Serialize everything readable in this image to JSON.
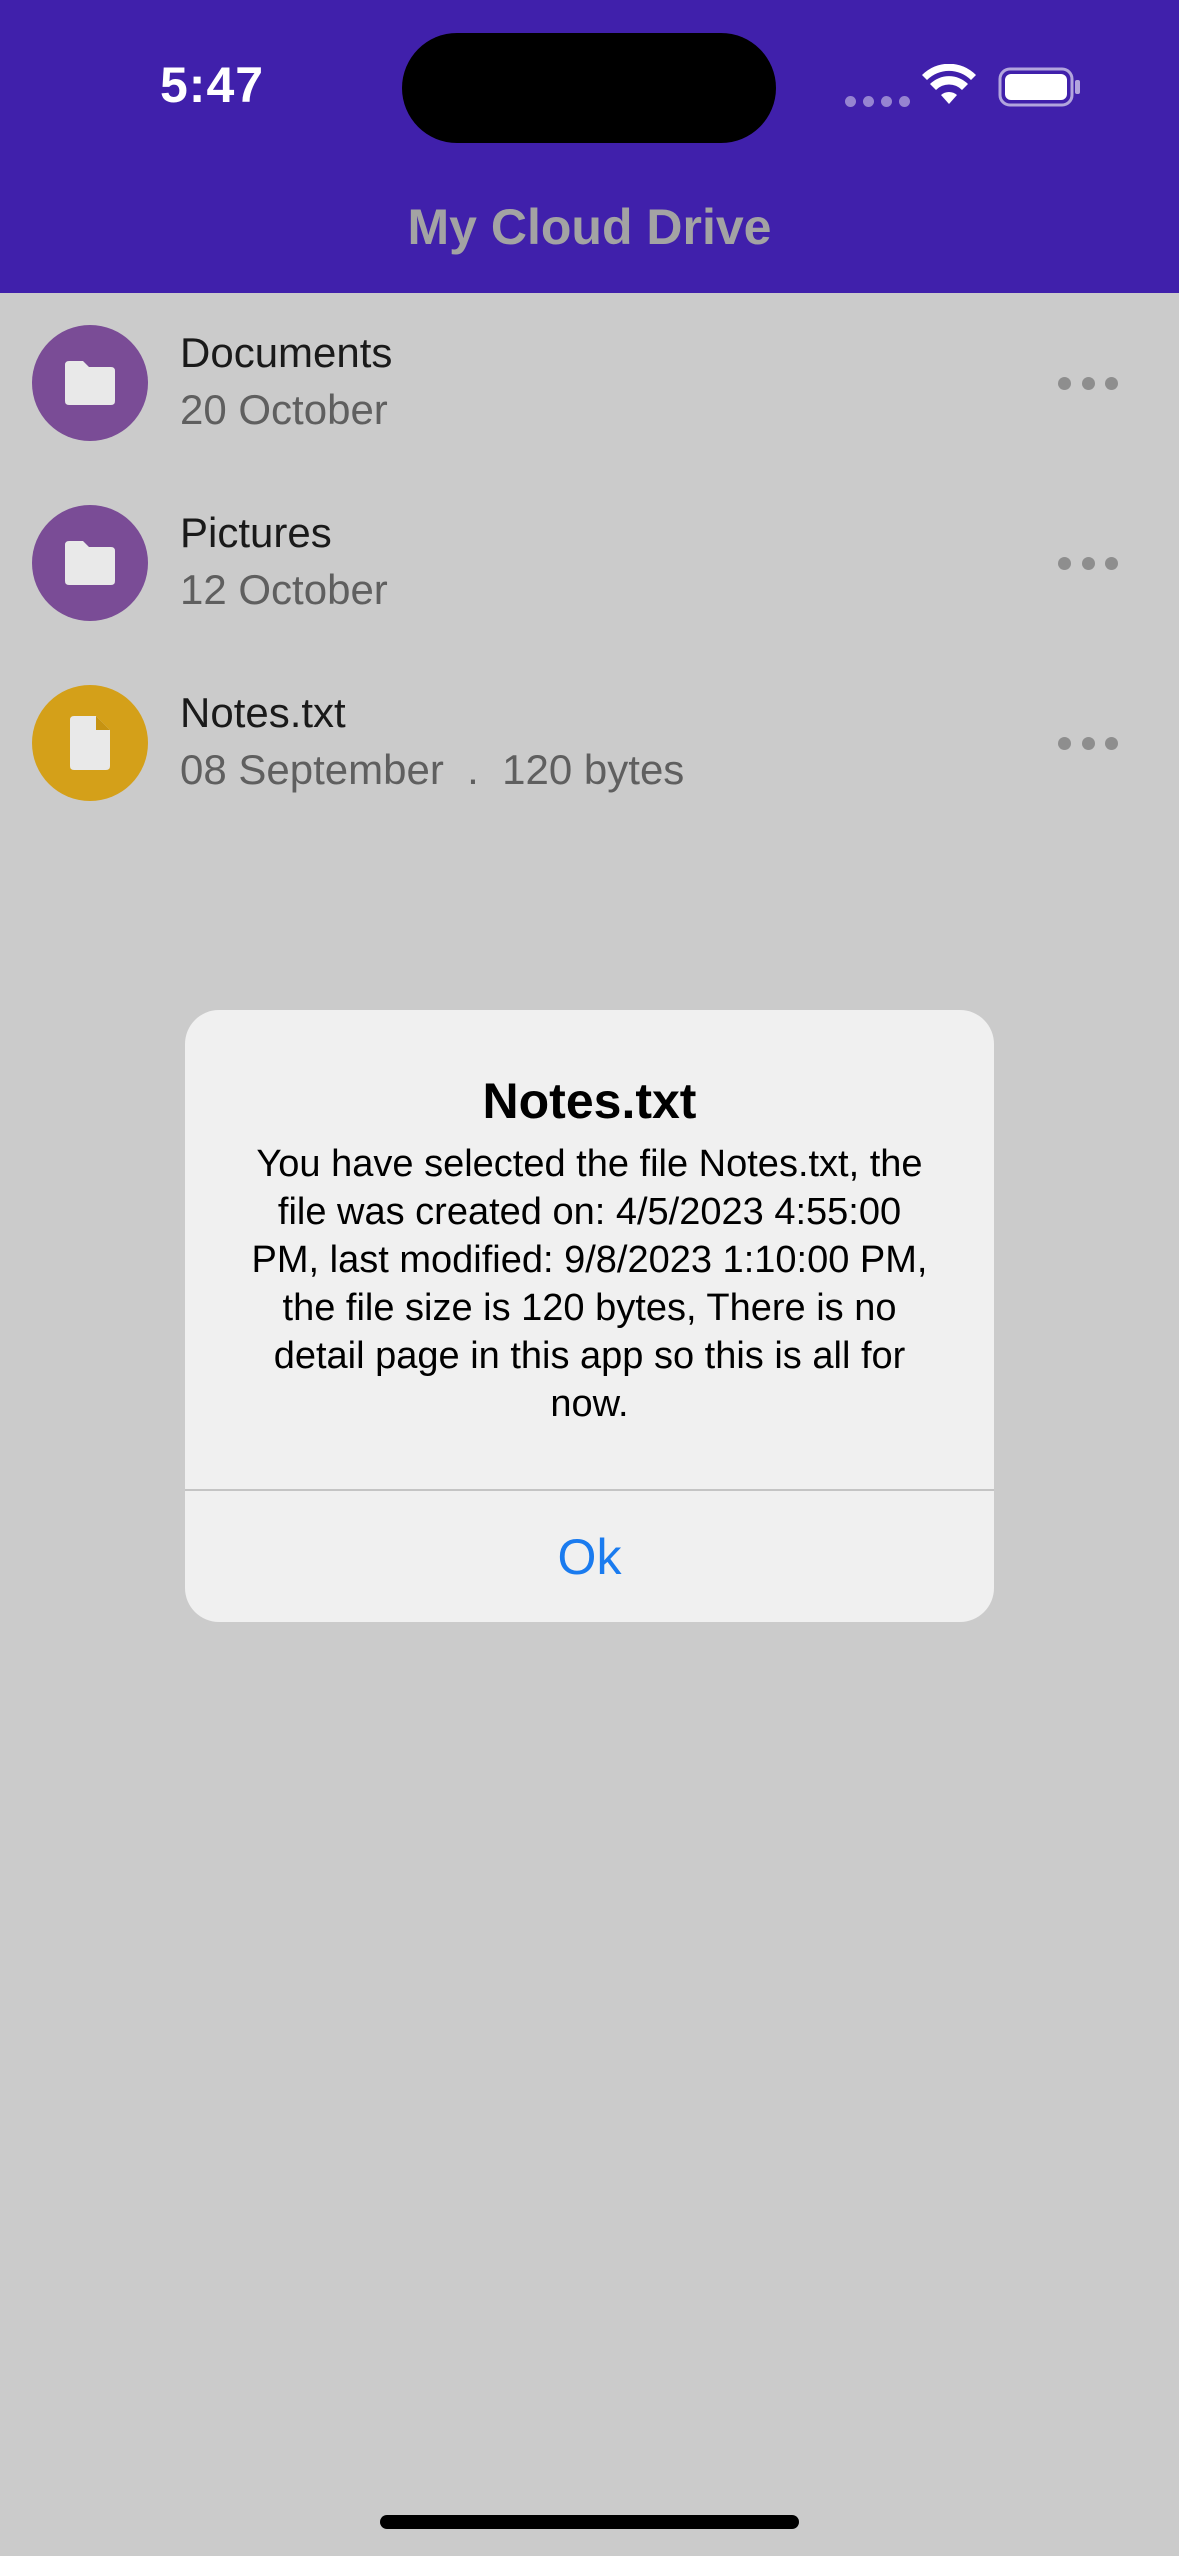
{
  "status_bar": {
    "time": "5:47"
  },
  "header": {
    "title": "My Cloud Drive",
    "background_color": "#4020ab"
  },
  "files": [
    {
      "name": "Documents",
      "meta": "20 October",
      "icon": "folder-icon",
      "color": "#7a4c96"
    },
    {
      "name": "Pictures",
      "meta": "12 October",
      "icon": "folder-icon",
      "color": "#7a4c96"
    },
    {
      "name": "Notes.txt",
      "meta": "08 September  .  120 bytes",
      "icon": "file-icon",
      "color": "#d4a019"
    }
  ],
  "dialog": {
    "title": "Notes.txt",
    "message": "You have selected the file Notes.txt, the file was created on: 4/5/2023 4:55:00 PM, last modified: 9/8/2023 1:10:00 PM, the file size is 120 bytes, There is no detail page in this app so this is all for now.",
    "ok_label": "Ok",
    "accent_color": "#1a7bef"
  }
}
